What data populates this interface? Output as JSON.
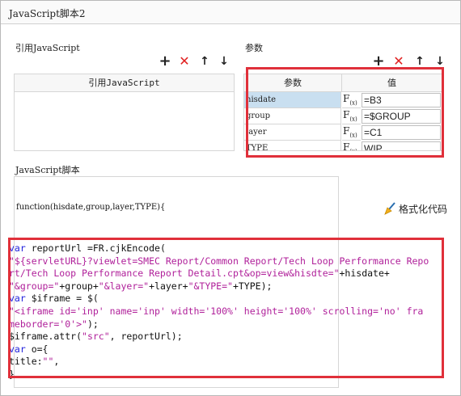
{
  "window": {
    "title": "JavaScript脚本2"
  },
  "references": {
    "section_label": "引用JavaScript",
    "column_header": "引用JavaScript",
    "toolbar": {
      "add_icon": "plus-icon",
      "delete_icon": "x-icon",
      "up_icon": "arrow-up-icon",
      "down_icon": "arrow-down-icon"
    }
  },
  "parameters": {
    "section_label": "参数",
    "column_name": "参数",
    "column_value": "值",
    "fx_label": "F",
    "fx_sub": "(x)",
    "rows": [
      {
        "name": "hisdate",
        "value": "=B3"
      },
      {
        "name": "group",
        "value": "=$GROUP"
      },
      {
        "name": "layer",
        "value": "=C1"
      },
      {
        "name": "TYPE",
        "value": "WIP"
      }
    ],
    "highlight_color": "#e0303a"
  },
  "script": {
    "section_label": "JavaScript脚本",
    "function_signature": "function(hisdate,group,layer,TYPE){",
    "format_button_label": "格式化代码",
    "format_button_icon": "broom-icon",
    "code_lines": [
      [
        {
          "t": "var",
          "c": "kw"
        },
        {
          "t": " reportUrl =FR.cjkEncode(",
          "c": ""
        }
      ],
      [
        {
          "t": "\"${servletURL}?viewlet=SMEC Report/Common Report/Tech Loop Performance Repo",
          "c": "str"
        }
      ],
      [
        {
          "t": "rt/Tech Loop Performance Report Detail.cpt&op=view&hisdte=\"",
          "c": "str"
        },
        {
          "t": "+hisdate+",
          "c": ""
        }
      ],
      [
        {
          "t": "\"&group=\"",
          "c": "str"
        },
        {
          "t": "+group+",
          "c": ""
        },
        {
          "t": "\"&layer=\"",
          "c": "str"
        },
        {
          "t": "+layer+",
          "c": ""
        },
        {
          "t": "\"&TYPE=\"",
          "c": "str"
        },
        {
          "t": "+TYPE);",
          "c": ""
        }
      ],
      [
        {
          "t": "var",
          "c": "kw"
        },
        {
          "t": " $iframe = $(",
          "c": ""
        }
      ],
      [
        {
          "t": "\"<iframe id='inp' name='inp' width='100%' height='100%' scrolling='no' fra",
          "c": "str"
        }
      ],
      [
        {
          "t": "meborder='0'>\"",
          "c": "str"
        },
        {
          "t": ");",
          "c": ""
        }
      ],
      [
        {
          "t": "$iframe.attr(",
          "c": ""
        },
        {
          "t": "\"src\"",
          "c": "str"
        },
        {
          "t": ", reportUrl);",
          "c": ""
        }
      ],
      [
        {
          "t": "var",
          "c": "kw"
        },
        {
          "t": " o={",
          "c": ""
        }
      ],
      [
        {
          "t": "title:",
          "c": ""
        },
        {
          "t": "\"\"",
          "c": "str"
        },
        {
          "t": ",",
          "c": ""
        }
      ],
      [
        {
          "t": "}",
          "c": ""
        }
      ]
    ]
  }
}
